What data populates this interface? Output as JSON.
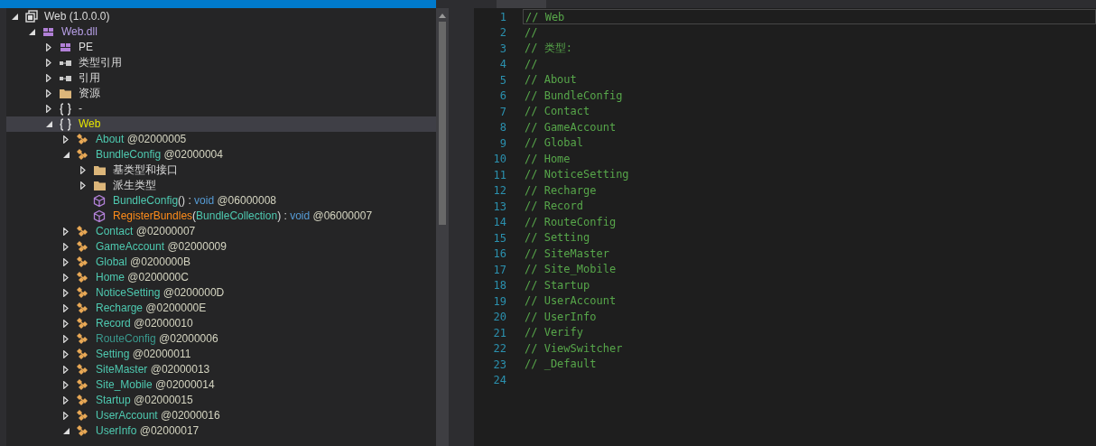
{
  "tree": [
    {
      "kind": "assembly",
      "expanded": true,
      "selected": false,
      "label": "Web (1.0.0.0)",
      "children": [
        {
          "kind": "module",
          "expanded": true,
          "selected": false,
          "label": "Web.dll",
          "children": [
            {
              "kind": "pe",
              "expanded": false,
              "selected": false,
              "label": "PE"
            },
            {
              "kind": "reference",
              "expanded": false,
              "selected": false,
              "label": "类型引用"
            },
            {
              "kind": "reference",
              "expanded": false,
              "selected": false,
              "label": "引用"
            },
            {
              "kind": "folder",
              "expanded": false,
              "selected": false,
              "label": "资源"
            },
            {
              "kind": "namespace",
              "expanded": false,
              "selected": false,
              "label": "-"
            },
            {
              "kind": "namespace",
              "expanded": true,
              "selected": true,
              "label": "Web",
              "children": [
                {
                  "kind": "class",
                  "expanded": false,
                  "selected": false,
                  "static": false,
                  "name": "About",
                  "token": "@02000005"
                },
                {
                  "kind": "class",
                  "expanded": true,
                  "selected": false,
                  "static": false,
                  "name": "BundleConfig",
                  "token": "@02000004",
                  "children": [
                    {
                      "kind": "folder",
                      "expanded": false,
                      "selected": false,
                      "label": "基类型和接口"
                    },
                    {
                      "kind": "folder",
                      "expanded": false,
                      "selected": false,
                      "label": "派生类型"
                    },
                    {
                      "kind": "constructor",
                      "selected": false,
                      "name": "BundleConfig",
                      "open": "(",
                      "close": ")",
                      "separator": ":",
                      "return_type": "void",
                      "token": "@06000008"
                    },
                    {
                      "kind": "method",
                      "selected": false,
                      "name": "RegisterBundles",
                      "open": "(",
                      "parameter": "BundleCollection",
                      "close": ")",
                      "separator": ":",
                      "return_type": "void",
                      "token": "@06000007"
                    }
                  ]
                },
                {
                  "kind": "class",
                  "expanded": false,
                  "selected": false,
                  "static": false,
                  "name": "Contact",
                  "token": "@02000007"
                },
                {
                  "kind": "class",
                  "expanded": false,
                  "selected": false,
                  "static": false,
                  "name": "GameAccount",
                  "token": "@02000009"
                },
                {
                  "kind": "class",
                  "expanded": false,
                  "selected": false,
                  "static": false,
                  "name": "Global",
                  "token": "@0200000B"
                },
                {
                  "kind": "class",
                  "expanded": false,
                  "selected": false,
                  "static": false,
                  "name": "Home",
                  "token": "@0200000C"
                },
                {
                  "kind": "class",
                  "expanded": false,
                  "selected": false,
                  "static": false,
                  "name": "NoticeSetting",
                  "token": "@0200000D"
                },
                {
                  "kind": "class",
                  "expanded": false,
                  "selected": false,
                  "static": false,
                  "name": "Recharge",
                  "token": "@0200000E"
                },
                {
                  "kind": "class",
                  "expanded": false,
                  "selected": false,
                  "static": false,
                  "name": "Record",
                  "token": "@02000010"
                },
                {
                  "kind": "class",
                  "expanded": false,
                  "selected": false,
                  "static": true,
                  "name": "RouteConfig",
                  "token": "@02000006"
                },
                {
                  "kind": "class",
                  "expanded": false,
                  "selected": false,
                  "static": false,
                  "name": "Setting",
                  "token": "@02000011"
                },
                {
                  "kind": "class",
                  "expanded": false,
                  "selected": false,
                  "static": false,
                  "name": "SiteMaster",
                  "token": "@02000013"
                },
                {
                  "kind": "class",
                  "expanded": false,
                  "selected": false,
                  "static": false,
                  "name": "Site_Mobile",
                  "token": "@02000014"
                },
                {
                  "kind": "class",
                  "expanded": false,
                  "selected": false,
                  "static": false,
                  "name": "Startup",
                  "token": "@02000015"
                },
                {
                  "kind": "class",
                  "expanded": false,
                  "selected": false,
                  "static": false,
                  "name": "UserAccount",
                  "token": "@02000016"
                },
                {
                  "kind": "class",
                  "expanded": true,
                  "selected": false,
                  "static": false,
                  "name": "UserInfo",
                  "token": "@02000017"
                }
              ]
            }
          ]
        }
      ]
    }
  ],
  "editor": {
    "lines": [
      {
        "number": "1",
        "current": true,
        "text": "// Web"
      },
      {
        "number": "2",
        "current": false,
        "text": "//"
      },
      {
        "number": "3",
        "current": false,
        "text": "// 类型:"
      },
      {
        "number": "4",
        "current": false,
        "text": "//"
      },
      {
        "number": "5",
        "current": false,
        "text": "// About"
      },
      {
        "number": "6",
        "current": false,
        "text": "// BundleConfig"
      },
      {
        "number": "7",
        "current": false,
        "text": "// Contact"
      },
      {
        "number": "8",
        "current": false,
        "text": "// GameAccount"
      },
      {
        "number": "9",
        "current": false,
        "text": "// Global"
      },
      {
        "number": "10",
        "current": false,
        "text": "// Home"
      },
      {
        "number": "11",
        "current": false,
        "text": "// NoticeSetting"
      },
      {
        "number": "12",
        "current": false,
        "text": "// Recharge"
      },
      {
        "number": "13",
        "current": false,
        "text": "// Record"
      },
      {
        "number": "14",
        "current": false,
        "text": "// RouteConfig"
      },
      {
        "number": "15",
        "current": false,
        "text": "// Setting"
      },
      {
        "number": "16",
        "current": false,
        "text": "// SiteMaster"
      },
      {
        "number": "17",
        "current": false,
        "text": "// Site_Mobile"
      },
      {
        "number": "18",
        "current": false,
        "text": "// Startup"
      },
      {
        "number": "19",
        "current": false,
        "text": "// UserAccount"
      },
      {
        "number": "20",
        "current": false,
        "text": "// UserInfo"
      },
      {
        "number": "21",
        "current": false,
        "text": "// Verify"
      },
      {
        "number": "22",
        "current": false,
        "text": "// ViewSwitcher"
      },
      {
        "number": "23",
        "current": false,
        "text": "// _Default"
      },
      {
        "number": "24",
        "current": false
      }
    ]
  }
}
